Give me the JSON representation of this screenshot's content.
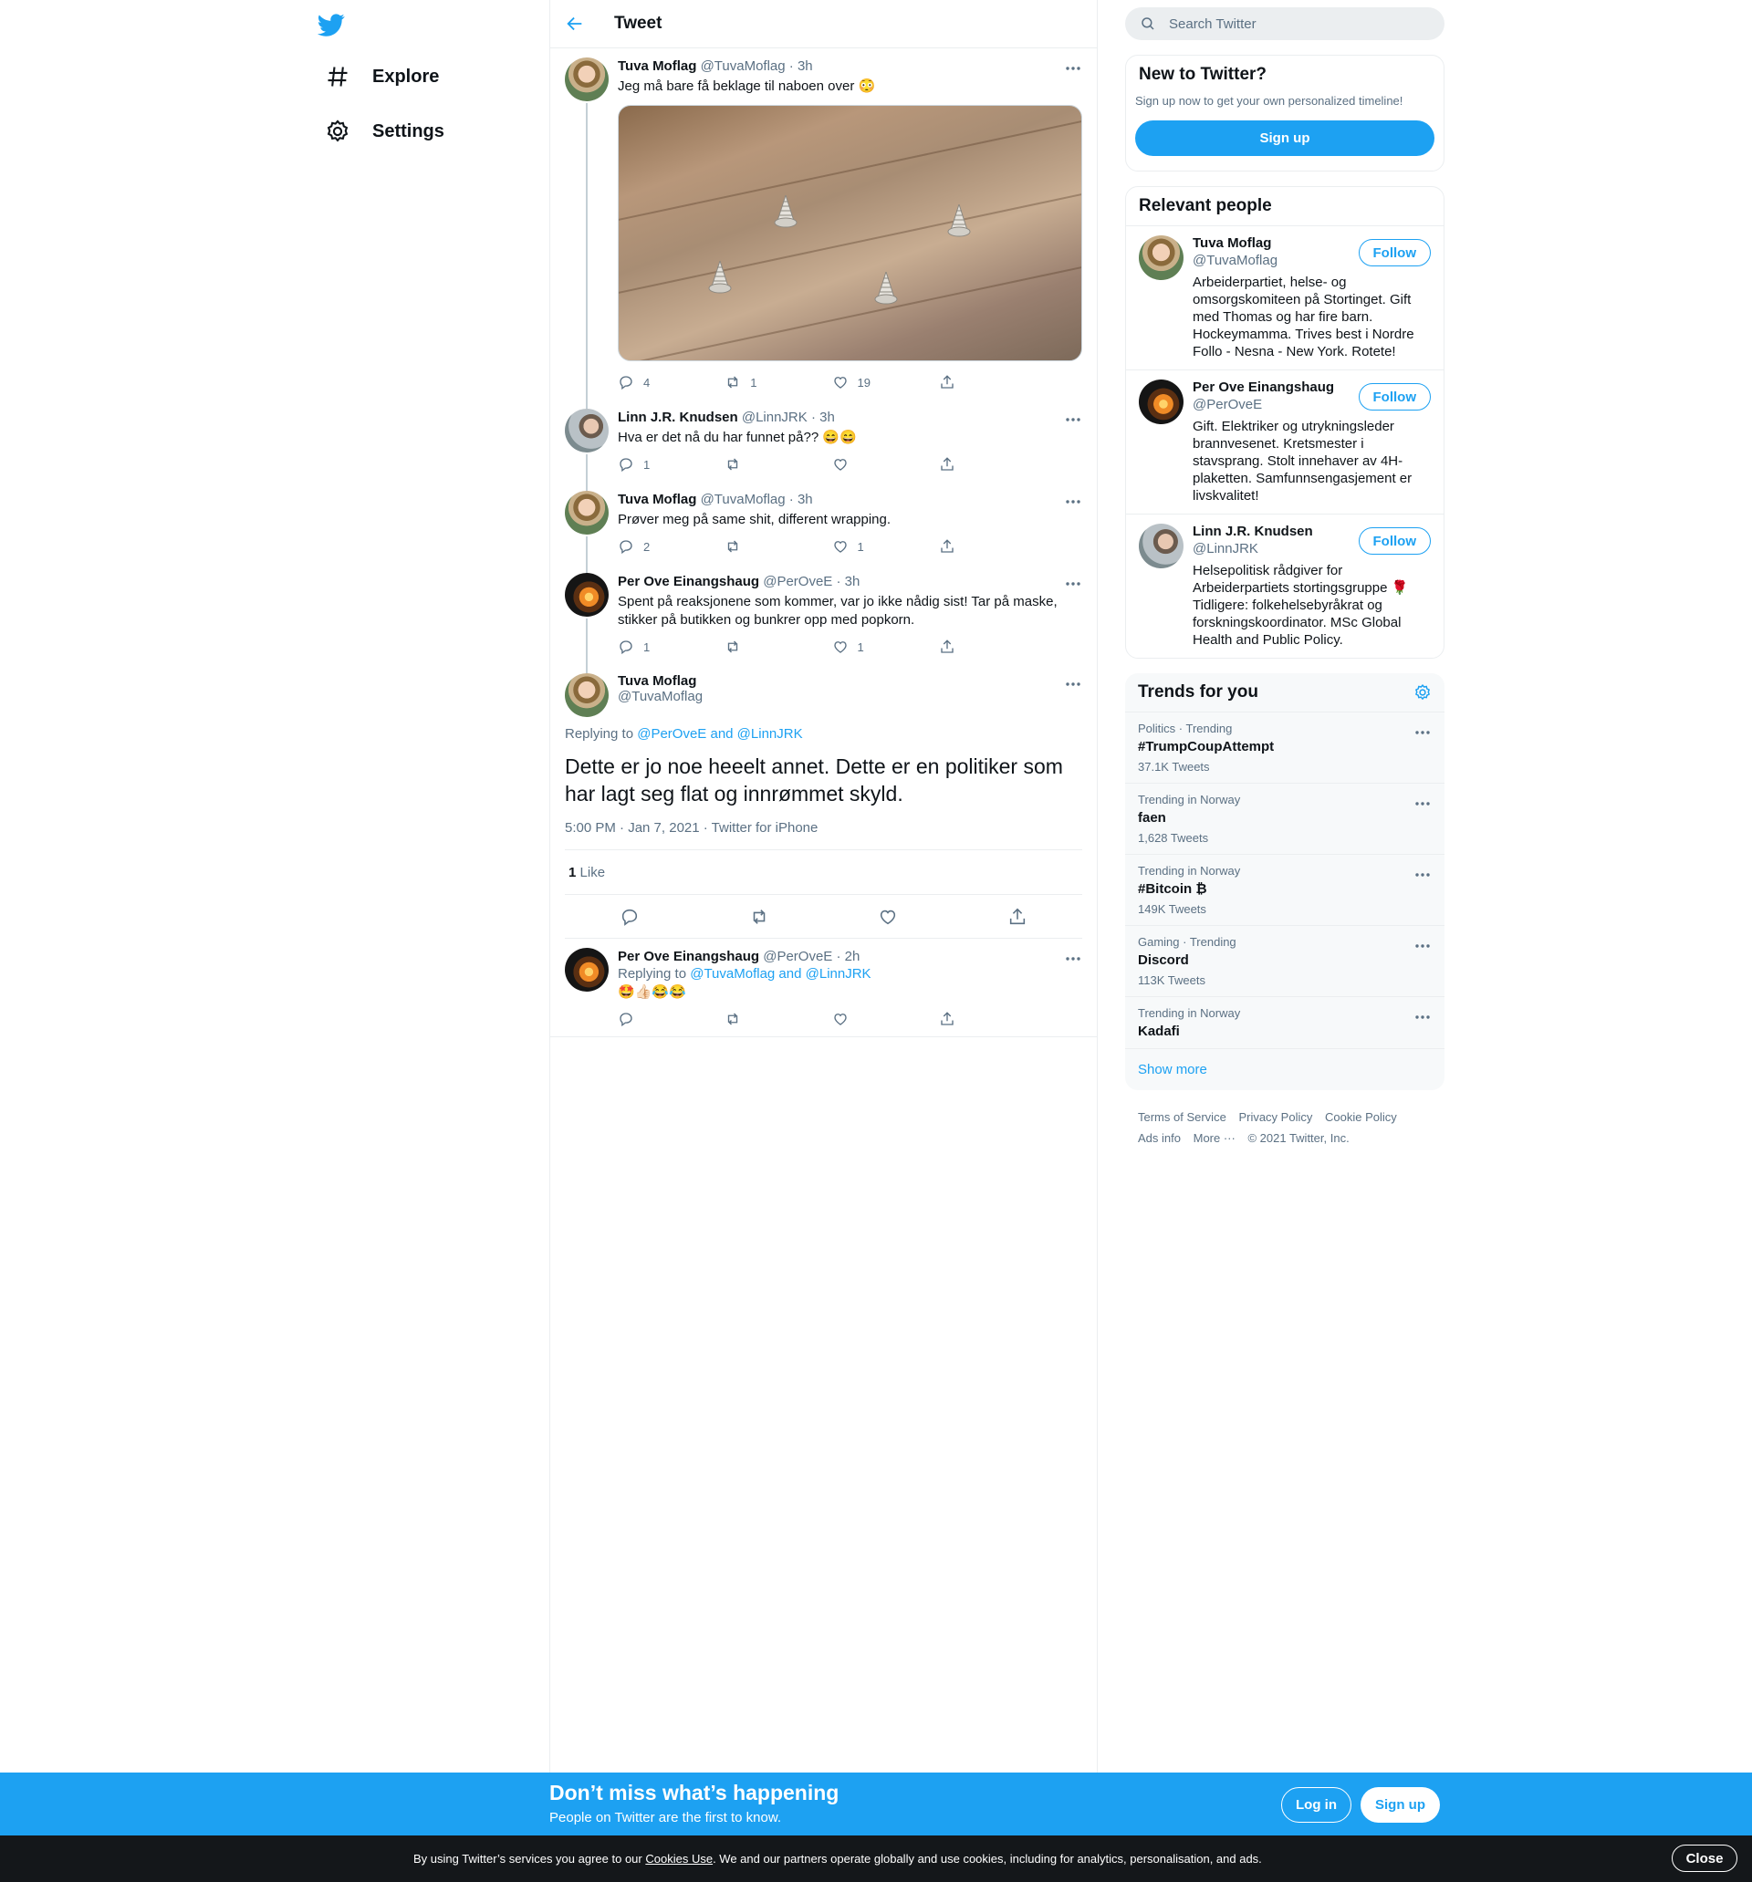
{
  "nav": {
    "logo_icon": "twitter-bird-icon",
    "items": [
      {
        "label": "Explore",
        "icon": "hashtag-icon"
      },
      {
        "label": "Settings",
        "icon": "gear-icon"
      }
    ]
  },
  "header": {
    "title": "Tweet",
    "back_icon": "arrow-left-icon"
  },
  "thread": [
    {
      "name": "Tuva Moflag",
      "handle": "@TuvaMoflag",
      "time": "· 3h",
      "text": "Jeg må bare få beklage til naboen over 😳",
      "replies": "4",
      "retweets": "1",
      "likes": "19"
    },
    {
      "name": "Linn J.R. Knudsen",
      "handle": "@LinnJRK",
      "time": "· 3h",
      "text": "Hva er det nå du har funnet på?? 😄😄",
      "replies": "1",
      "retweets": "",
      "likes": ""
    },
    {
      "name": "Tuva Moflag",
      "handle": "@TuvaMoflag",
      "time": "· 3h",
      "text": "Prøver meg på same shit, different wrapping.",
      "replies": "2",
      "retweets": "",
      "likes": "1"
    },
    {
      "name": "Per Ove Einangshaug",
      "handle": "@PerOveE",
      "time": "· 3h",
      "text": "Spent på reaksjonene som kommer, var jo ikke nådig sist! Tar på maske, stikker på butikken og bunkrer opp med popkorn.",
      "replies": "1",
      "retweets": "",
      "likes": "1"
    }
  ],
  "focus": {
    "name": "Tuva Moflag",
    "handle": "@TuvaMoflag",
    "replying_prefix": "Replying to",
    "replying_to": "@PerOveE and @LinnJRK",
    "text": "Dette er jo noe heeelt annet. Dette er en politiker som har lagt seg flat og innrømmet skyld.",
    "timestamp": "5:00 PM · Jan 7, 2021 · Twitter for iPhone",
    "like_count": "1",
    "like_label": "Like"
  },
  "reply": {
    "name": "Per Ove Einangshaug",
    "handle": "@PerOveE",
    "time": "· 2h",
    "replying_prefix": "Replying to",
    "replying_to": "@TuvaMoflag and @LinnJRK",
    "text": "🤩👍🏻😂😂"
  },
  "search": {
    "placeholder": "Search Twitter"
  },
  "signup_box": {
    "title": "New to Twitter?",
    "subtitle": "Sign up now to get your own personalized timeline!",
    "button": "Sign up"
  },
  "relevant": {
    "title": "Relevant people",
    "follow_label": "Follow",
    "people": [
      {
        "name": "Tuva Moflag",
        "handle": "@TuvaMoflag",
        "bio": "Arbeiderpartiet, helse- og omsorgskomiteen på Stortinget. Gift med Thomas og har fire barn. Hockeymamma. Trives best i Nordre Follo - Nesna - New York. Rotete!"
      },
      {
        "name": "Per Ove Einangshaug",
        "handle": "@PerOveE",
        "bio": "Gift. Elektriker og utrykningsleder brannvesenet. Kretsmester i stavsprang. Stolt innehaver av 4H-plaketten. Samfunnsengasjement er livskvalitet!"
      },
      {
        "name": "Linn J.R. Knudsen",
        "handle": "@LinnJRK",
        "bio": "Helsepolitisk rådgiver for Arbeiderpartiets stortingsgruppe 🌹 Tidligere: folkehelsebyråkrat og forskningskoordinator. MSc Global Health and Public Policy."
      }
    ]
  },
  "trends": {
    "title": "Trends for you",
    "items": [
      {
        "context": "Politics · Trending",
        "name": "#TrumpCoupAttempt",
        "count": "37.1K Tweets"
      },
      {
        "context": "Trending in Norway",
        "name": "faen",
        "count": "1,628 Tweets"
      },
      {
        "context": "Trending in Norway",
        "name": "#Bitcoin ₿",
        "count": "149K Tweets"
      },
      {
        "context": "Gaming · Trending",
        "name": "Discord",
        "count": "113K Tweets"
      },
      {
        "context": "Trending in Norway",
        "name": "Kadafi",
        "count": ""
      }
    ],
    "show_more": "Show more"
  },
  "footer": {
    "links": [
      "Terms of Service",
      "Privacy Policy",
      "Cookie Policy",
      "Ads info",
      "More ···"
    ],
    "copyright": "© 2021 Twitter, Inc."
  },
  "bottom_bar": {
    "title": "Don’t miss what’s happening",
    "subtitle": "People on Twitter are the first to know.",
    "login": "Log in",
    "signup": "Sign up"
  },
  "cookie": {
    "text_before": "By using Twitter’s services you agree to our ",
    "link": "Cookies Use",
    "text_after": ". We and our partners operate globally and use cookies, including for analytics, personalisation, and ads.",
    "close": "Close"
  },
  "colors": {
    "accent": "#1da1f2",
    "text": "#0f1419",
    "secondary": "#5b7083",
    "cookie_bg": "#14171a"
  }
}
